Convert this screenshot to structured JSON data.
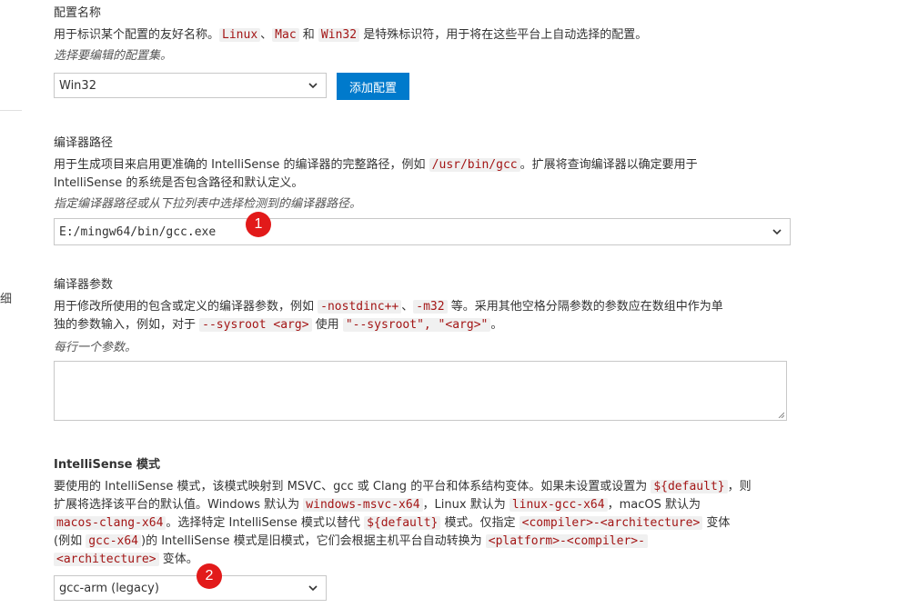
{
  "left_panel": {
    "cut_text": "细"
  },
  "config_name": {
    "title": "配置名称",
    "desc": {
      "p1": "用于标识某个配置的友好名称。",
      "c1": "Linux",
      "p2": "、",
      "c2": "Mac",
      "p3": " 和 ",
      "c3": "Win32",
      "p4": " 是特殊标识符，用于将在这些平台上自动选择的配置。"
    },
    "hint": "选择要编辑的配置集。",
    "select_value": "Win32",
    "add_button": "添加配置"
  },
  "compiler_path": {
    "title": "编译器路径",
    "desc": {
      "p1": "用于生成项目来启用更准确的 IntelliSense 的编译器的完整路径，例如 ",
      "c1": "/usr/bin/gcc",
      "p2": "。扩展将查询编译器以确定要用于",
      "p3": "IntelliSense 的系统是否包含路径和默认定义。"
    },
    "hint": "指定编译器路径或从下拉列表中选择检测到的编译器路径。",
    "select_value": "E:/mingw64/bin/gcc.exe",
    "badge": "1"
  },
  "compiler_args": {
    "title": "编译器参数",
    "desc": {
      "p1": "用于修改所使用的包含或定义的编译器参数，例如 ",
      "c1": "-nostdinc++",
      "p2": "、",
      "c2": "-m32",
      "p3": " 等。采用其他空格分隔参数的参数应在数组中作为单",
      "p4": "独的参数输入，例如，对于 ",
      "c3": "--sysroot <arg>",
      "p5": " 使用 ",
      "c4": "\"--sysroot\", \"<arg>\"",
      "p6": "。"
    },
    "hint": "每行一个参数。",
    "textarea_value": ""
  },
  "intellisense_mode": {
    "title": "IntelliSense 模式",
    "desc": {
      "p1": "要使用的 IntelliSense 模式，该模式映射到 MSVC、gcc 或 Clang 的平台和体系结构变体。如果未设置或设置为 ",
      "c1": "${default}",
      "p2": "，则",
      "p3": "扩展将选择该平台的默认值。Windows 默认为 ",
      "c2": "windows-msvc-x64",
      "p4": "，Linux 默认为 ",
      "c3": "linux-gcc-x64",
      "p5": "，macOS 默认为",
      "c4": "macos-clang-x64",
      "p6": "。选择特定 IntelliSense 模式以替代 ",
      "c5": "${default}",
      "p7": " 模式。仅指定 ",
      "c6": "<compiler>-<architecture>",
      "p8": " 变体",
      "p9": "(例如 ",
      "c7": "gcc-x64",
      "p10": ")的 IntelliSense 模式是旧模式，它们会根据主机平台自动转换为 ",
      "c8": "<platform>-<compiler>-",
      "c9": "<architecture>",
      "p11": " 变体。"
    },
    "select_value": "gcc-arm (legacy)",
    "badge": "2"
  },
  "icons": {
    "dropdown": "chevron-down-icon",
    "resize": "resize-grip-icon"
  },
  "colors": {
    "accent": "#007acc",
    "badge": "#e21a1a",
    "code_text": "#a31515"
  }
}
